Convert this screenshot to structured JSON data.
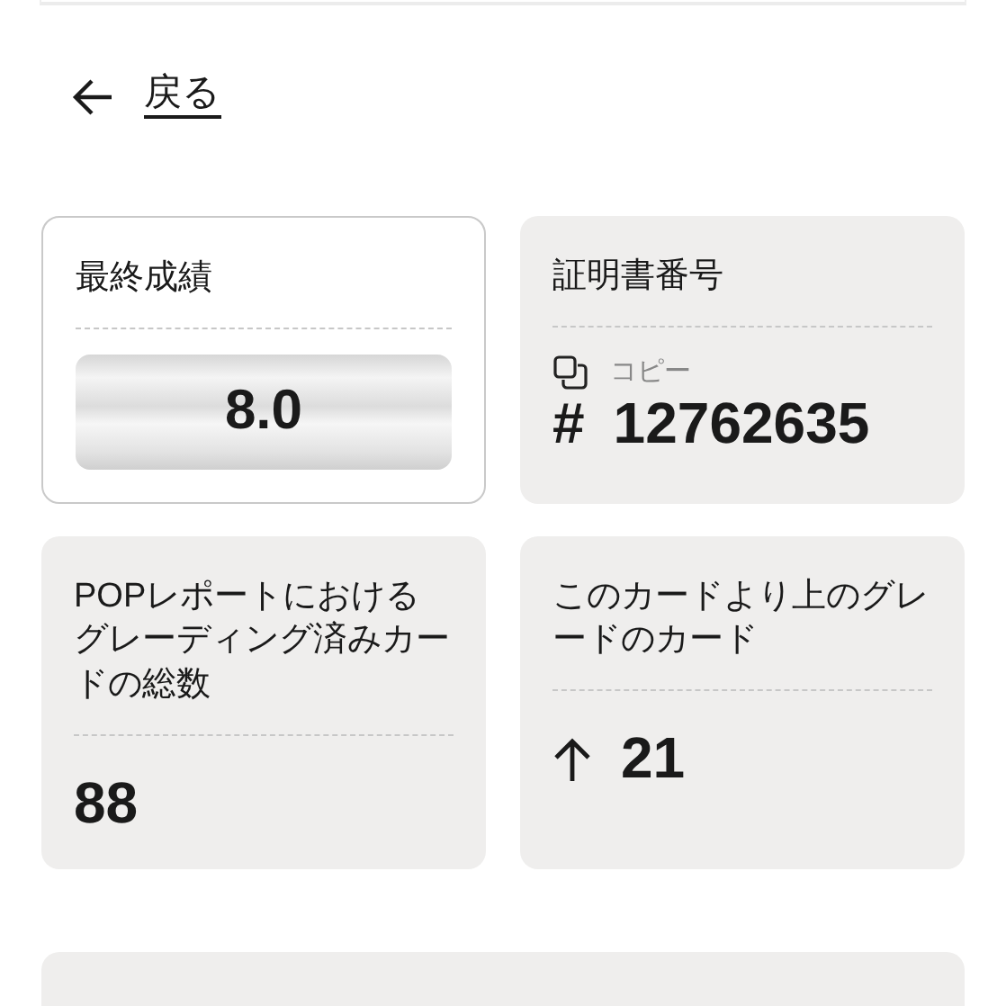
{
  "back_link": {
    "label": "戻る"
  },
  "cards": [
    {
      "kind": "grade",
      "label": "最終成績",
      "value": "8.0"
    },
    {
      "kind": "cert",
      "label": "証明書番号",
      "copy_label": "コピー",
      "prefix": "#",
      "value": "12762635"
    },
    {
      "kind": "count",
      "label": "POPレポートにおけるグレーディング済みカードの総数",
      "value": "88"
    },
    {
      "kind": "higher",
      "label": "このカードより上のグレードのカード",
      "value": "21"
    }
  ]
}
